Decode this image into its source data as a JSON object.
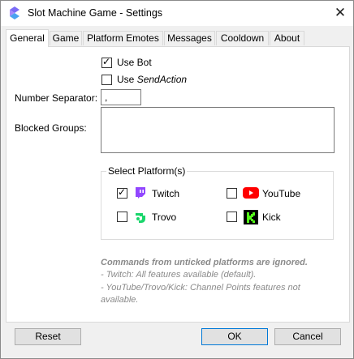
{
  "window": {
    "title": "Slot Machine Game - Settings",
    "close_glyph": "✕"
  },
  "tabs": [
    {
      "label": "General"
    },
    {
      "label": "Game"
    },
    {
      "label": "Platform Emotes"
    },
    {
      "label": "Messages"
    },
    {
      "label": "Cooldown"
    },
    {
      "label": "About"
    }
  ],
  "general": {
    "use_bot": {
      "label": "Use Bot",
      "checked": true
    },
    "use_send_action": {
      "label_prefix": "Use ",
      "label_italic": "SendAction",
      "checked": false
    },
    "number_separator": {
      "label": "Number Separator:",
      "value": ","
    },
    "blocked_groups": {
      "label": "Blocked Groups:",
      "value": ""
    },
    "platform_group": {
      "title": "Select Platform(s)",
      "platforms": [
        {
          "name": "Twitch",
          "checked": true,
          "icon": "twitch-icon",
          "color": "#9146ff"
        },
        {
          "name": "YouTube",
          "checked": false,
          "icon": "youtube-icon",
          "color": "#ff0000"
        },
        {
          "name": "Trovo",
          "checked": false,
          "icon": "trovo-icon",
          "color": "#19d66b"
        },
        {
          "name": "Kick",
          "checked": false,
          "icon": "kick-icon",
          "color": "#53fc18"
        }
      ]
    },
    "notes": {
      "heading": "Commands from unticked platforms are ignored.",
      "line1": "- Twitch: All features available (default).",
      "line2a": "- YouTube/Trovo/Kick: Channel Points features not",
      "line2b": "available."
    }
  },
  "buttons": {
    "reset": "Reset",
    "ok": "OK",
    "cancel": "Cancel"
  }
}
